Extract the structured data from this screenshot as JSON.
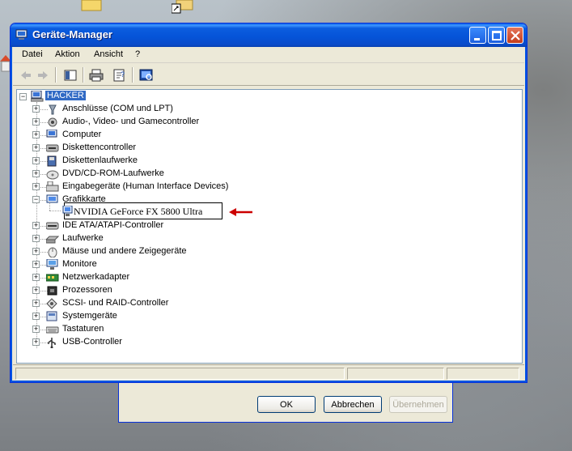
{
  "window": {
    "title": "Geräte-Manager"
  },
  "menu": [
    "Datei",
    "Aktion",
    "Ansicht",
    "?"
  ],
  "toolbar": {
    "icons": [
      "back-arrow-icon",
      "forward-arrow-icon",
      "show-hide-tree-icon",
      "print-icon",
      "properties-icon",
      "scan-hardware-icon"
    ]
  },
  "tree": {
    "root": "HACKER",
    "categories": [
      {
        "label": "Anschlüsse (COM und LPT)",
        "icon": "port-icon",
        "expanded": false
      },
      {
        "label": "Audio-, Video- und Gamecontroller",
        "icon": "audio-icon",
        "expanded": false
      },
      {
        "label": "Computer",
        "icon": "computer-icon",
        "expanded": false
      },
      {
        "label": "Diskettencontroller",
        "icon": "floppy-controller-icon",
        "expanded": false
      },
      {
        "label": "Diskettenlaufwerke",
        "icon": "floppy-drive-icon",
        "expanded": false
      },
      {
        "label": "DVD/CD-ROM-Laufwerke",
        "icon": "cdrom-icon",
        "expanded": false
      },
      {
        "label": "Eingabegeräte (Human Interface Devices)",
        "icon": "hid-icon",
        "expanded": false
      },
      {
        "label": "Grafikkarte",
        "icon": "display-adapter-icon",
        "expanded": true
      },
      {
        "label": "IDE ATA/ATAPI-Controller",
        "icon": "ide-icon",
        "expanded": false
      },
      {
        "label": "Laufwerke",
        "icon": "disk-drive-icon",
        "expanded": false
      },
      {
        "label": "Mäuse und andere Zeigegeräte",
        "icon": "mouse-icon",
        "expanded": false
      },
      {
        "label": "Monitore",
        "icon": "monitor-icon",
        "expanded": false
      },
      {
        "label": "Netzwerkadapter",
        "icon": "network-adapter-icon",
        "expanded": false
      },
      {
        "label": "Prozessoren",
        "icon": "processor-icon",
        "expanded": false
      },
      {
        "label": "SCSI- und RAID-Controller",
        "icon": "scsi-icon",
        "expanded": false
      },
      {
        "label": "Systemgeräte",
        "icon": "system-device-icon",
        "expanded": false
      },
      {
        "label": "Tastaturen",
        "icon": "keyboard-icon",
        "expanded": false
      },
      {
        "label": "USB-Controller",
        "icon": "usb-icon",
        "expanded": false
      }
    ],
    "selected_device": "NVIDIA GeForce FX 5800 Ultra"
  },
  "background_dialog": {
    "ok_label": "OK",
    "cancel_label": "Abbrechen",
    "apply_label": "Übernehmen"
  },
  "colors": {
    "titlebar": "#0553d7",
    "selection": "#316ac5",
    "annotation_arrow": "#cc0000"
  }
}
